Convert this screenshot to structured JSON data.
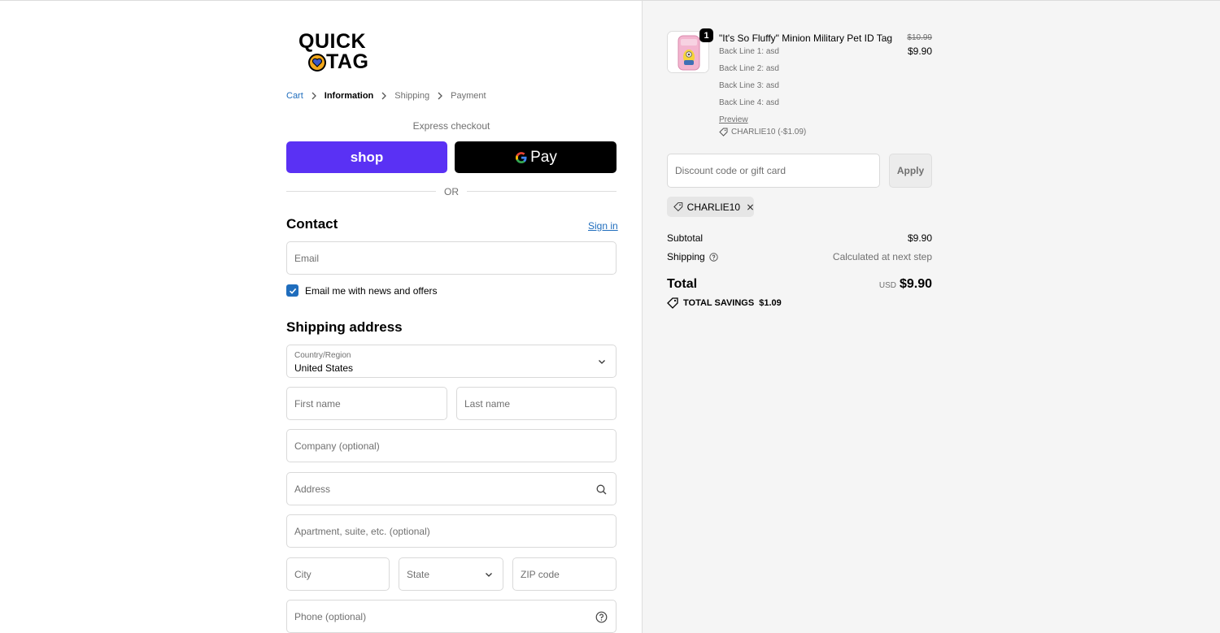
{
  "brand": {
    "logo_line1": "QUICK",
    "logo_line2": "TAG"
  },
  "breadcrumb": {
    "cart": "Cart",
    "information": "Information",
    "shipping": "Shipping",
    "payment": "Payment"
  },
  "express": {
    "label": "Express checkout",
    "shop_label": "shop",
    "gpay_label": "Pay",
    "or": "OR"
  },
  "contact": {
    "heading": "Contact",
    "sign_in": "Sign in",
    "email_placeholder": "Email",
    "newsletter_label": "Email me with news and offers",
    "newsletter_checked": true
  },
  "shipping_address": {
    "heading": "Shipping address",
    "country_label": "Country/Region",
    "country_value": "United States",
    "first_name": "First name",
    "last_name": "Last name",
    "company": "Company (optional)",
    "address": "Address",
    "apartment": "Apartment, suite, etc. (optional)",
    "city": "City",
    "state": "State",
    "zip": "ZIP code",
    "phone": "Phone (optional)"
  },
  "order": {
    "item": {
      "quantity": "1",
      "name": "\"It's So Fluffy\" Minion Military Pet ID Tag",
      "lines": [
        "Back Line 1: asd",
        "Back Line 2: asd",
        "Back Line 3: asd",
        "Back Line 4: asd"
      ],
      "preview": "Preview",
      "discount": "CHARLIE10 (-$1.09)",
      "original_price": "$10.99",
      "price": "$9.90"
    },
    "discount_placeholder": "Discount code or gift card",
    "apply_label": "Apply",
    "applied_code": "CHARLIE10",
    "subtotal_label": "Subtotal",
    "subtotal_value": "$9.90",
    "shipping_label": "Shipping",
    "shipping_value": "Calculated at next step",
    "total_label": "Total",
    "total_currency": "USD",
    "total_value": "$9.90",
    "savings_label": "TOTAL SAVINGS",
    "savings_value": "$1.09"
  },
  "colors": {
    "accent": "#1f6dbd",
    "shop_pay": "#5a31f4",
    "sidebar_bg": "#f5f5f5"
  }
}
